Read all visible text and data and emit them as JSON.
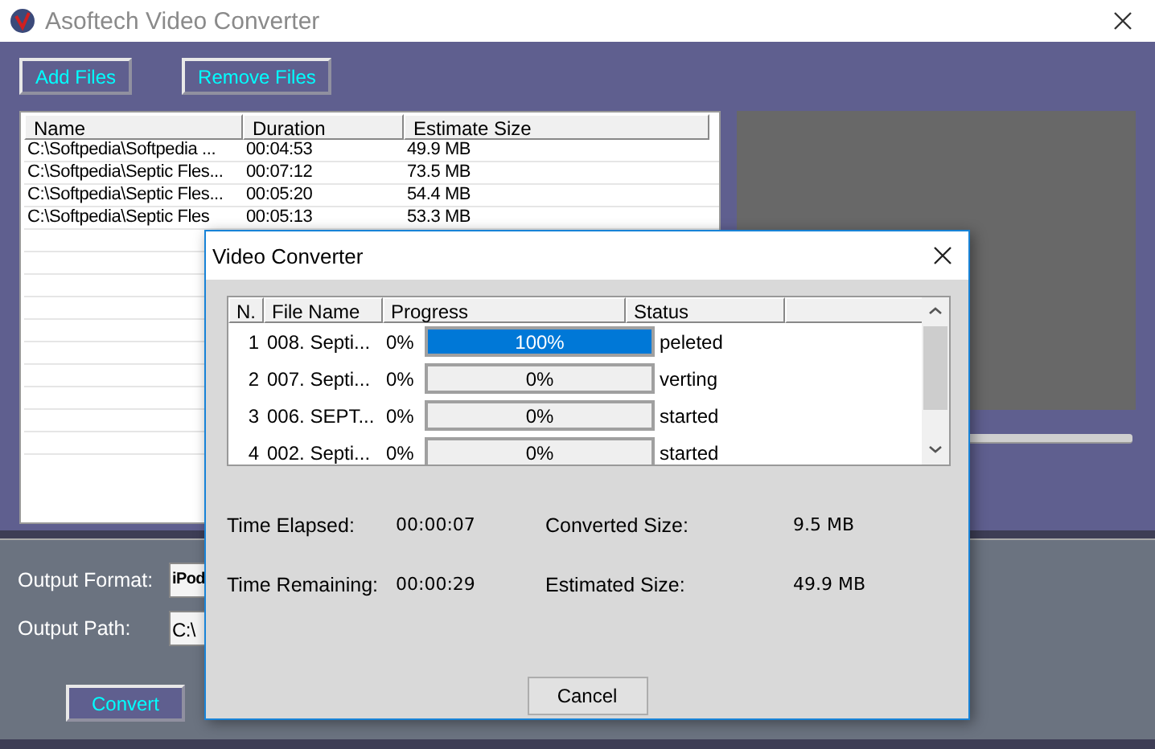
{
  "window": {
    "title": "Asoftech Video Converter"
  },
  "toolbar": [
    "Add Files",
    "Remove Files"
  ],
  "file_table": {
    "columns": [
      "Name",
      "Duration",
      "Estimate Size"
    ],
    "rows": [
      [
        "C:\\Softpedia\\Softpedia ...",
        "00:04:53",
        "49.9 MB"
      ],
      [
        "C:\\Softpedia\\Septic Fles...",
        "00:07:12",
        "73.5 MB"
      ],
      [
        "C:\\Softpedia\\Septic Fles...",
        "00:05:20",
        "54.4 MB"
      ],
      [
        "C:\\Softpedia\\Septic Fles",
        "00:05:13",
        "53.3 MB"
      ]
    ]
  },
  "output": {
    "format_label": "Output Format:",
    "format_value": "iPod",
    "path_label": "Output Path:",
    "path_value": "C:\\"
  },
  "convert_button": "Convert",
  "dialog": {
    "title": "Video Converter",
    "columns": [
      "N.",
      "File Name",
      "Progress",
      "Status"
    ],
    "rows": [
      {
        "number": "1",
        "file_name": "008. Septi...",
        "percent": "0%",
        "level": 1,
        "bar_text": "100%",
        "status": "peleted"
      },
      {
        "number": "2",
        "file_name": "007. Septi...",
        "percent": "0%",
        "level": 0,
        "bar_text": "0%",
        "status": "verting"
      },
      {
        "number": "3",
        "file_name": "006. SEPT...",
        "percent": "0%",
        "level": 0,
        "bar_text": "0%",
        "status": "started"
      },
      {
        "number": "4",
        "file_name": "002. Septi...",
        "percent": "0%",
        "level": 0,
        "bar_text": "0%",
        "status": "started"
      }
    ],
    "stats": [
      {
        "label": "Time Elapsed:",
        "value": "00:00:07"
      },
      {
        "label": "Converted Size:",
        "value": "9.5 MB"
      },
      {
        "label": "Time Remaining:",
        "value": "00:00:29"
      },
      {
        "label": "Estimated Size:",
        "value": "49.9 MB"
      }
    ],
    "cancel_button": "Cancel"
  }
}
